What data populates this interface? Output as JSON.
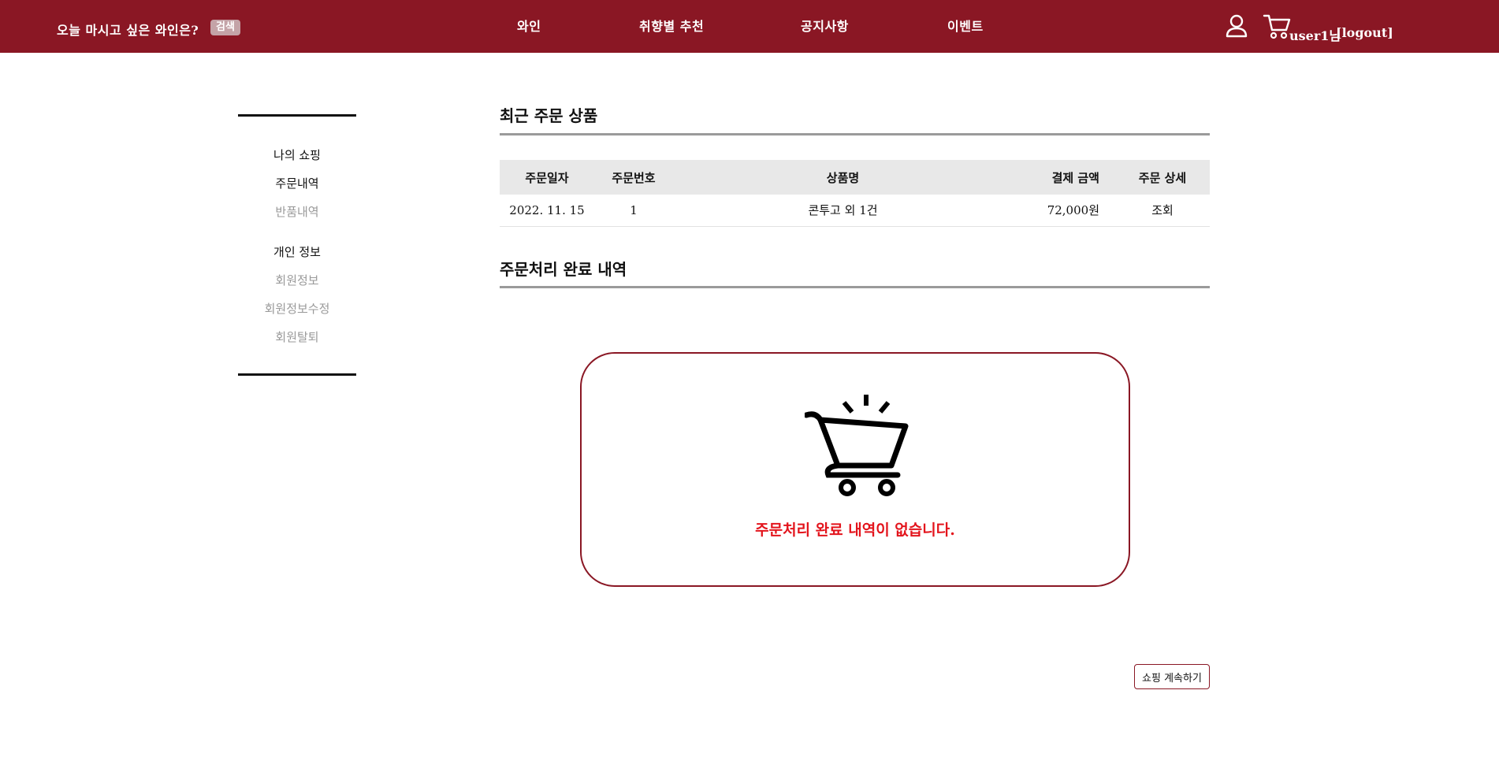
{
  "header": {
    "search_prompt": "오늘 마시고 싶은 와인은?",
    "search_button": "검색",
    "nav": [
      "와인",
      "취향별 추천",
      "공지사항",
      "이벤트"
    ],
    "username": "user1님",
    "logout": "[logout]",
    "icons": [
      "user-icon",
      "cart-icon"
    ]
  },
  "sidebar": {
    "shopping_heading": "나의 쇼핑",
    "order_history": "주문내역",
    "return_history": "반품내역",
    "info_heading": "개인 정보",
    "member_info": "회원정보",
    "member_edit": "회원정보수정",
    "member_withdraw": "회원탈퇴"
  },
  "recent_orders": {
    "title": "최근 주문 상품",
    "columns": [
      "주문일자",
      "주문번호",
      "상품명",
      "결제 금액",
      "주문 상세"
    ],
    "rows": [
      {
        "date": "2022. 11. 15",
        "number": "1",
        "product": "콘투고 외 1건",
        "amount": "72,000원",
        "detail": "조회"
      }
    ]
  },
  "completed_orders": {
    "title": "주문처리 완료 내역",
    "empty_message": "주문처리 완료 내역이 없습니다.",
    "empty_icon": "cart-icon"
  },
  "continue_button": "쇼핑 계속하기",
  "colors": {
    "brand": "#8a1724",
    "empty_message": "#e3141c",
    "muted_link": "#999999"
  }
}
